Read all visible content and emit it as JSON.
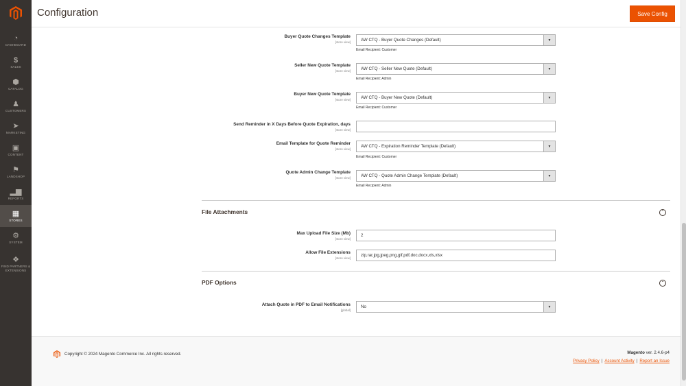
{
  "header": {
    "title": "Configuration",
    "save_label": "Save Config"
  },
  "colors": {
    "accent": "#eb5202",
    "sidebar": "#373330",
    "sidebar_active": "#524d49"
  },
  "sidebar": {
    "items": [
      {
        "label": "DASHBOARD",
        "icon": "dashboard-icon"
      },
      {
        "label": "SALES",
        "icon": "dollar-icon"
      },
      {
        "label": "CATALOG",
        "icon": "cube-icon"
      },
      {
        "label": "CUSTOMERS",
        "icon": "person-icon"
      },
      {
        "label": "MARKETING",
        "icon": "megaphone-icon"
      },
      {
        "label": "CONTENT",
        "icon": "content-icon"
      },
      {
        "label": "LANDSHOP",
        "icon": "flag-icon"
      },
      {
        "label": "REPORTS",
        "icon": "bar-chart-icon"
      },
      {
        "label": "STORES",
        "icon": "store-icon"
      },
      {
        "label": "SYSTEM",
        "icon": "gear-icon"
      },
      {
        "label": "FIND PARTNERS & EXTENSIONS",
        "icon": "boxes-icon"
      }
    ]
  },
  "email_rows": [
    {
      "label": "Buyer Quote Changes Template",
      "scope": "[store view]",
      "value": "AW CTQ - Buyer Quote Changes (Default)",
      "note": "Email Recipient: Customer"
    },
    {
      "label": "Seller New Quote Template",
      "scope": "[store view]",
      "value": "AW CTQ - Seller New Quote (Default)",
      "note": "Email Recipient: Admin"
    },
    {
      "label": "Buyer New Quote Template",
      "scope": "[store view]",
      "value": "AW CTQ - Buyer New Quote (Default)",
      "note": "Email Recipient: Customer"
    },
    {
      "label": "Send Reminder in X Days Before Quote Expiration, days",
      "scope": "[store view]",
      "value": ""
    },
    {
      "label": "Email Template for Quote Reminder",
      "scope": "[store view]",
      "value": "AW CTQ - Expiration Reminder Template (Default)",
      "note": "Email Recipient: Customer"
    },
    {
      "label": "Quote Admin Change Template",
      "scope": "[store view]",
      "value": "AW CTQ - Quote Admin Change Template (Default)",
      "note": "Email Recipient: Admin"
    }
  ],
  "file_attachments": {
    "title": "File Attachments",
    "rows": [
      {
        "label": "Max Upload File Size (Mb)",
        "scope": "[store view]",
        "value": "2"
      },
      {
        "label": "Allow File Extensions",
        "scope": "[store view]",
        "value": "zip,rar,jpg,jpeg,png,gif,pdf,doc,docx,xls,xlsx"
      }
    ]
  },
  "pdf_options": {
    "title": "PDF Options",
    "rows": [
      {
        "label": "Attach Quote in PDF to Email Notifications",
        "scope": "[global]",
        "value": "No"
      }
    ]
  },
  "footer": {
    "copyright": "Copyright © 2024 Magento Commerce Inc. All rights reserved.",
    "brand": "Magento",
    "version": "ver. 2.4.6-p4",
    "links": [
      "Privacy Policy",
      "Account Activity",
      "Report an Issue"
    ]
  }
}
